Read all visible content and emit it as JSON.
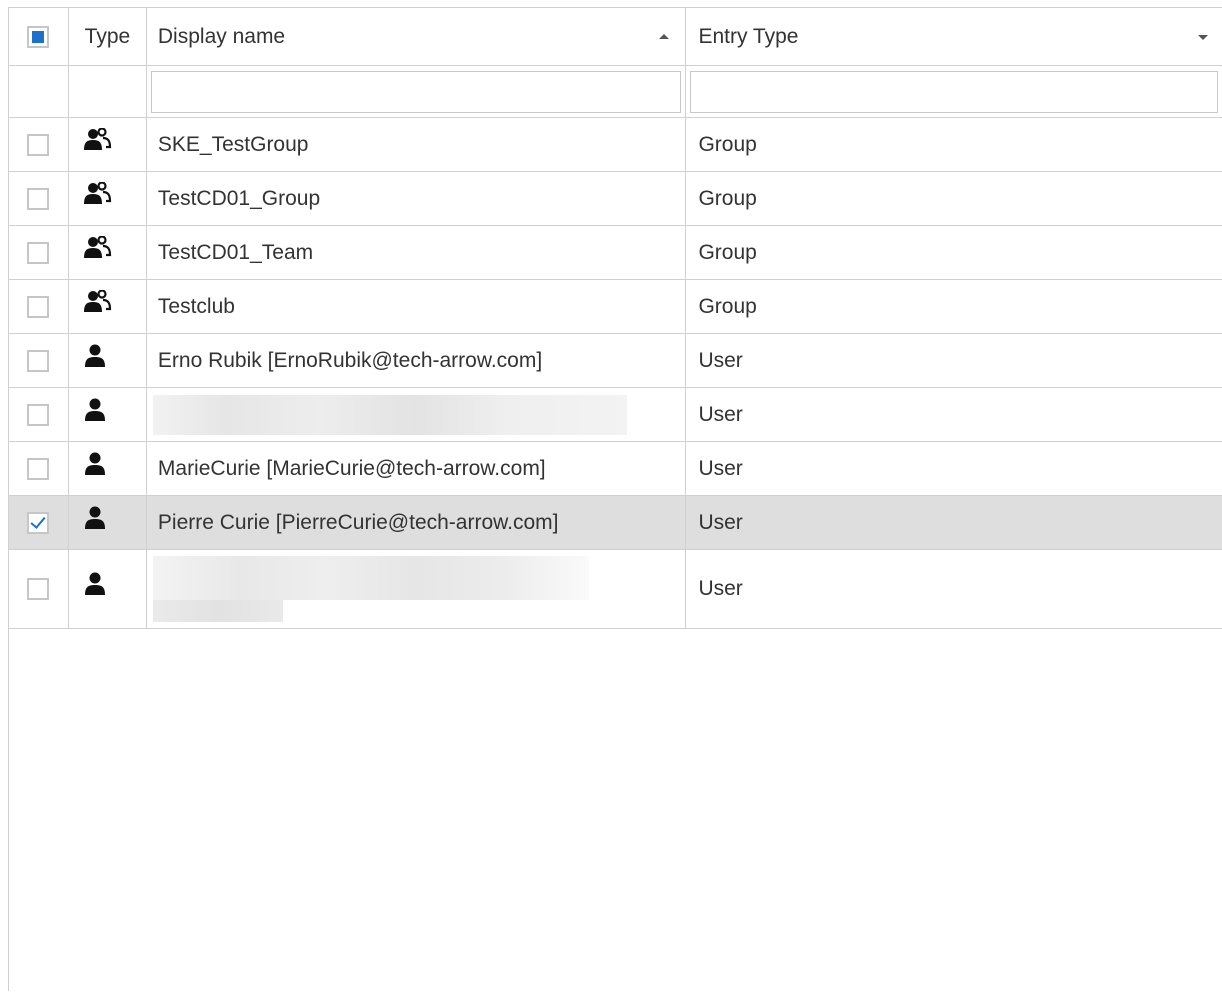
{
  "header": {
    "type_label": "Type",
    "display_name_label": "Display name",
    "entry_type_label": "Entry Type",
    "select_all_state": "partial"
  },
  "filter": {
    "display_name_value": "",
    "entry_type_value": ""
  },
  "rows": [
    {
      "icon": "group-icon",
      "display_name": "SKE_TestGroup",
      "entry_type": "Group",
      "checked": false
    },
    {
      "icon": "group-icon",
      "display_name": "TestCD01_Group",
      "entry_type": "Group",
      "checked": false
    },
    {
      "icon": "group-icon",
      "display_name": "TestCD01_Team",
      "entry_type": "Group",
      "checked": false
    },
    {
      "icon": "group-icon",
      "display_name": "Testclub",
      "entry_type": "Group",
      "checked": false
    },
    {
      "icon": "user-icon",
      "display_name": "Erno Rubik [ErnoRubik@tech-arrow.com]",
      "entry_type": "User",
      "checked": false
    },
    {
      "icon": "user-icon",
      "display_name": "",
      "entry_type": "User",
      "checked": false
    },
    {
      "icon": "user-icon",
      "display_name": "MarieCurie [MarieCurie@tech-arrow.com]",
      "entry_type": "User",
      "checked": false
    },
    {
      "icon": "user-icon",
      "display_name": "Pierre Curie [PierreCurie@tech-arrow.com]",
      "entry_type": "User",
      "checked": true
    },
    {
      "icon": "user-icon",
      "display_name": "",
      "entry_type": "User",
      "checked": false
    }
  ],
  "colors": {
    "accent": "#1a73c8",
    "selected_row": "#dedede",
    "border": "#d0d0d0"
  }
}
